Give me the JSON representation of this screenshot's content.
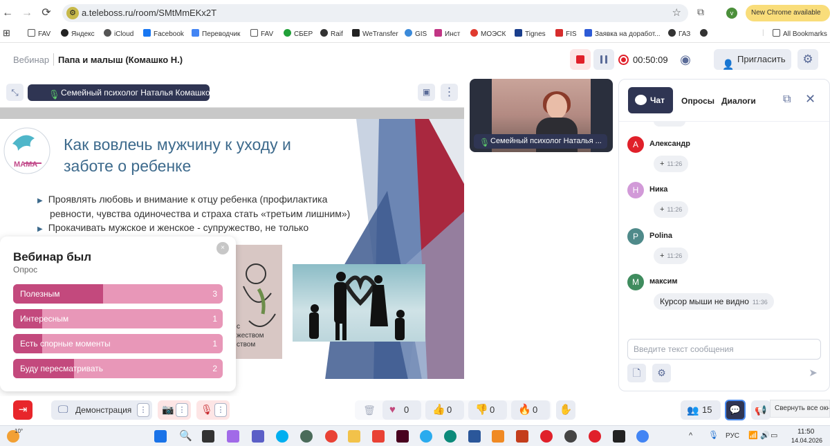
{
  "browser": {
    "url": "a.teleboss.ru/room/SMtMmEKx2T",
    "profile_initial": "v",
    "update_label": "New Chrome available",
    "bookmarks": [
      {
        "label": "FAV",
        "color": "#555555"
      },
      {
        "label": "Яндекс",
        "color": "#222222"
      },
      {
        "label": "iCloud",
        "color": "#555555"
      },
      {
        "label": "Facebook",
        "color": "#1877f2"
      },
      {
        "label": "Переводчик",
        "color": "#4285f4"
      },
      {
        "label": "FAV",
        "color": "#555555"
      },
      {
        "label": "СБЕР",
        "color": "#21a038"
      },
      {
        "label": "Raif",
        "color": "#333333"
      },
      {
        "label": "WeTransfer",
        "color": "#222222"
      },
      {
        "label": "GIS",
        "color": "#3b8ad9"
      },
      {
        "label": "Инст",
        "color": "#c13584"
      },
      {
        "label": "МОЭСК",
        "color": "#e03a2f"
      },
      {
        "label": "Tignes",
        "color": "#1a3e8c"
      },
      {
        "label": "FIS",
        "color": "#d62d2d"
      },
      {
        "label": "Заявка на доработ...",
        "color": "#2d5bd6"
      },
      {
        "label": "ГАЗ",
        "color": "#333333"
      },
      {
        "label": "",
        "color": "#333333"
      }
    ],
    "all_bookmarks": "All Bookmarks"
  },
  "header": {
    "section": "Вебинар",
    "title": "Папа и малыш (Комашко Н.)",
    "record_time": "00:50:09",
    "invite_label": "Пригласить"
  },
  "stage": {
    "speaker_label": "Семейный психолог Наталья Комашко",
    "slide": {
      "title_line1": "Как вовлечь мужчину к уходу и",
      "title_line2": "заботе о ребенке",
      "bullet1_line1": "Проявлять любовь и внимание к отцу ребенка (профилактика",
      "bullet1_line2": "ревности, чувства  одиночества и страха стать «третьим лишним»)",
      "bullet2": "Прокачивать мужское и женское - супружество, не только",
      "logo_text": "МАМА",
      "drawing_text": "с\nжеством\nством"
    }
  },
  "poll": {
    "title": "Вебинар был",
    "subtitle": "Опрос",
    "close_icon": "×",
    "options": [
      {
        "label": "Полезным",
        "count": "3",
        "fraction": 0.43
      },
      {
        "label": "Интересным",
        "count": "1",
        "fraction": 0.14
      },
      {
        "label": "Есть спорные моменты",
        "count": "1",
        "fraction": 0.14
      },
      {
        "label": "Буду пересматривать",
        "count": "2",
        "fraction": 0.29
      }
    ]
  },
  "video": {
    "label": "Семейный психолог Наталья ..."
  },
  "chat": {
    "tabs": {
      "chat": "Чат",
      "polls": "Опросы",
      "dialogs": "Диалоги"
    },
    "messages": [
      {
        "initial": "А",
        "name": "Александр",
        "color": "#e0202a",
        "text": "",
        "time": "11:26"
      },
      {
        "initial": "Н",
        "name": "Ника",
        "color": "#d29ad8",
        "text": "",
        "time": "11:26"
      },
      {
        "initial": "P",
        "name": "Polina",
        "color": "#4f8a8a",
        "text": "",
        "time": "11:26"
      },
      {
        "initial": "М",
        "name": "максим",
        "color": "#3f8c5e",
        "text": "Курсор мыши не видно",
        "time": "11:36"
      }
    ],
    "input_placeholder": "Введите текст сообщения"
  },
  "toolbar": {
    "demo_label": "Демонстрация",
    "reactions": {
      "like": "0",
      "thumbs_up": "0",
      "thumbs_down": "0",
      "fire": "0"
    },
    "participants": "15",
    "tooltip": "Свернуть все окна"
  },
  "taskbar": {
    "weather": "10°",
    "lang": "РУС",
    "time": "11:50",
    "date": "14.04.2026"
  }
}
